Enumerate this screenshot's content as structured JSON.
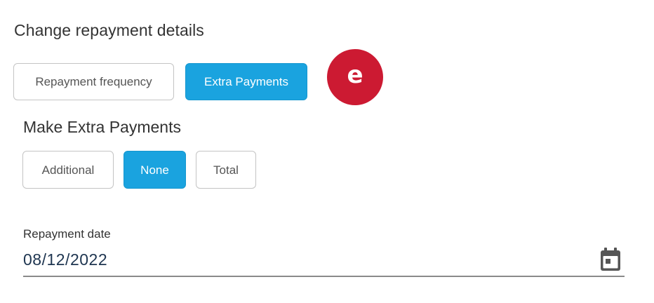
{
  "header": {
    "title": "Change repayment details"
  },
  "mode_tabs": [
    {
      "label": "Repayment frequency",
      "selected": false
    },
    {
      "label": "Extra Payments",
      "selected": true
    }
  ],
  "step_badge": {
    "letter": "e",
    "color": "#cc1a32"
  },
  "extra_payments": {
    "title": "Make Extra Payments",
    "options": [
      {
        "label": "Additional",
        "selected": false
      },
      {
        "label": "None",
        "selected": true
      },
      {
        "label": "Total",
        "selected": false
      }
    ]
  },
  "repayment_date": {
    "label": "Repayment date",
    "value": "08/12/2022",
    "icon": "calendar-icon"
  },
  "colors": {
    "accent": "#1aa3df",
    "badge": "#cc1a32",
    "border": "#c4c4c4",
    "date_text": "#1e3550"
  }
}
